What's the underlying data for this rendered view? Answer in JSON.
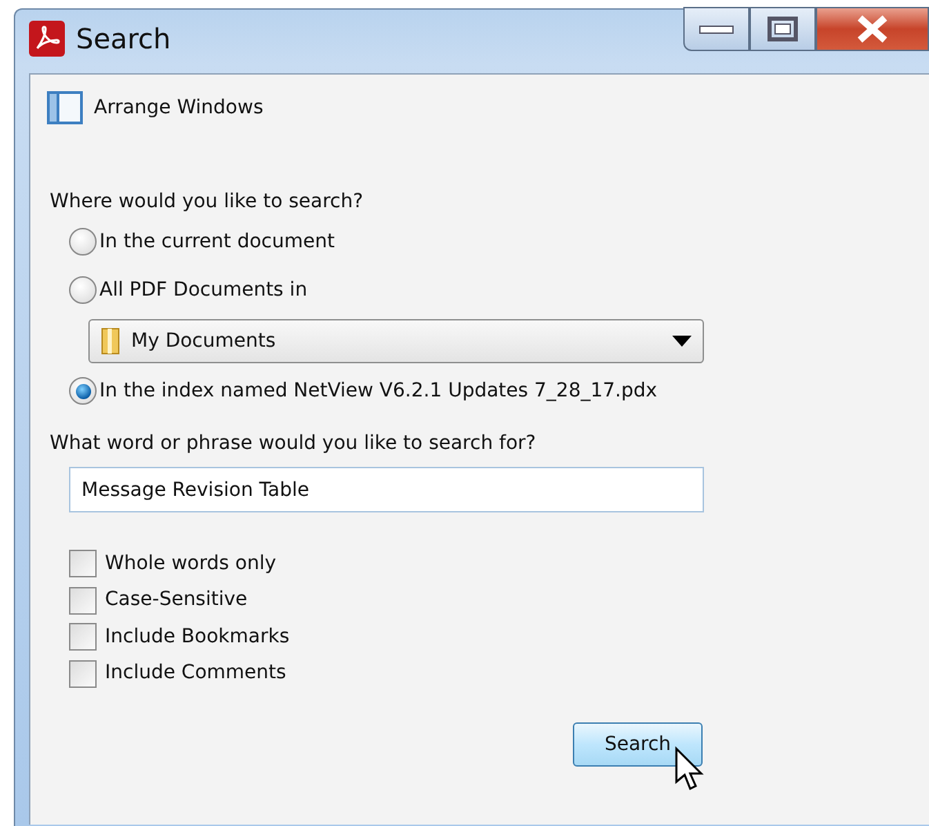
{
  "window": {
    "title": "Search"
  },
  "toolbar": {
    "label": "Arrange Windows"
  },
  "location": {
    "question": "Where would you like to search?",
    "options": [
      {
        "label": "In the current document",
        "selected": false
      },
      {
        "label": "All PDF Documents in",
        "selected": false
      },
      {
        "label": "In the index named NetView V6.2.1 Updates 7_28_17.pdx",
        "selected": true
      }
    ],
    "folder": "My Documents"
  },
  "phrase": {
    "question": "What word or phrase would you like to search for?",
    "value": "Message Revision Table"
  },
  "options": [
    {
      "label": "Whole words only",
      "checked": false
    },
    {
      "label": "Case-Sensitive",
      "checked": false
    },
    {
      "label": "Include Bookmarks",
      "checked": false
    },
    {
      "label": "Include Comments",
      "checked": false
    }
  ],
  "buttons": [
    "Search"
  ]
}
